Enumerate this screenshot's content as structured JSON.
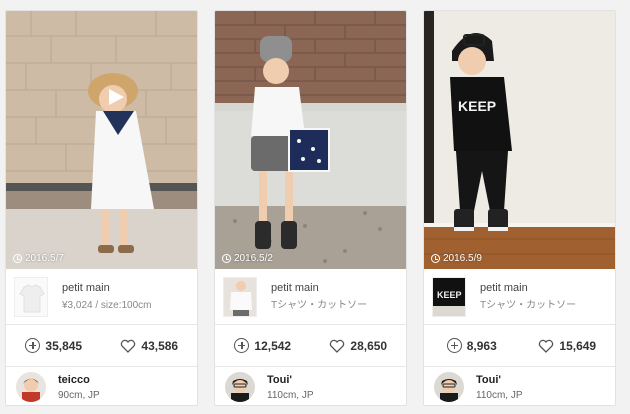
{
  "cards": [
    {
      "date": "2016.5/7",
      "item": {
        "brand": "petit main",
        "sub": "¥3,024 / size:100cm"
      },
      "stats": {
        "save_count": "35,845",
        "like_count": "43,586"
      },
      "user": {
        "name": "teicco",
        "meta": "90cm, JP"
      }
    },
    {
      "date": "2016.5/2",
      "item": {
        "brand": "petit main",
        "sub": "Tシャツ・カットソー"
      },
      "stats": {
        "save_count": "12,542",
        "like_count": "28,650"
      },
      "user": {
        "name": "Toui'",
        "meta": "110cm, JP"
      }
    },
    {
      "date": "2016.5/9",
      "item": {
        "brand": "petit main",
        "sub": "Tシャツ・カットソー"
      },
      "stats": {
        "save_count": "8,963",
        "like_count": "15,649"
      },
      "user": {
        "name": "Toui'",
        "meta": "110cm, JP"
      }
    }
  ]
}
